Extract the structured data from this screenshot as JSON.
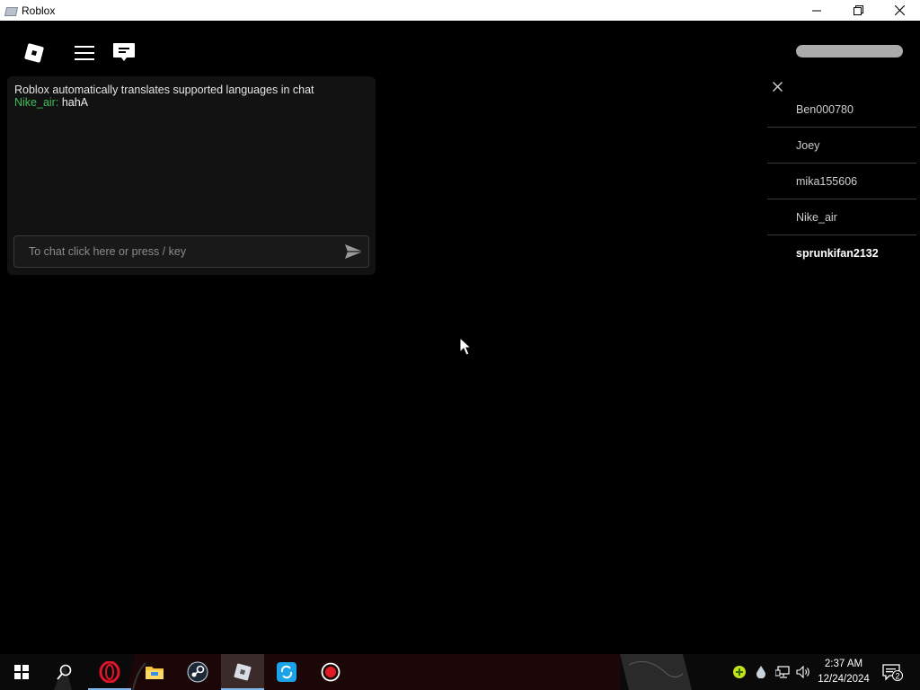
{
  "window": {
    "title": "Roblox",
    "minimize_icon": "minimize-icon",
    "restore_icon": "restore-icon",
    "close_icon": "close-icon"
  },
  "topbar": {
    "logo_icon": "roblox-logo-icon",
    "menu_icon": "hamburger-menu-icon",
    "chat_icon": "chat-bubble-icon"
  },
  "chat": {
    "system_message": "Roblox automatically translates supported languages in chat",
    "messages": [
      {
        "user": "Nike_air:",
        "text": "hahA",
        "user_color": "#3fbf5a"
      }
    ],
    "input_placeholder": "To chat click here or press / key",
    "send_icon": "send-arrow-icon"
  },
  "players": {
    "close_icon": "close-icon",
    "list": [
      "Ben000780",
      "Joey",
      "mika155606",
      "Nike_air",
      "sprunkifan2132"
    ],
    "local_player": "sprunkifan2132"
  },
  "taskbar": {
    "apps": [
      {
        "name": "start",
        "icon": "windows-start-icon"
      },
      {
        "name": "search",
        "icon": "search-icon"
      },
      {
        "name": "opera",
        "icon": "opera-browser-icon",
        "active": true
      },
      {
        "name": "file-explorer",
        "icon": "folder-icon"
      },
      {
        "name": "steam",
        "icon": "steam-icon"
      },
      {
        "name": "roblox",
        "icon": "roblox-icon",
        "active": true,
        "current": true
      },
      {
        "name": "sync-app",
        "icon": "sync-icon"
      },
      {
        "name": "recorder",
        "icon": "record-icon"
      }
    ],
    "tray_icons": [
      "green-status-icon",
      "droplet-icon",
      "network-icon",
      "volume-icon"
    ],
    "time": "2:37 AM",
    "date": "12/24/2024",
    "notification_count": "2"
  },
  "colors": {
    "chat_username": "#3fbf5a",
    "taskbar_active": "#7fb4e8"
  }
}
